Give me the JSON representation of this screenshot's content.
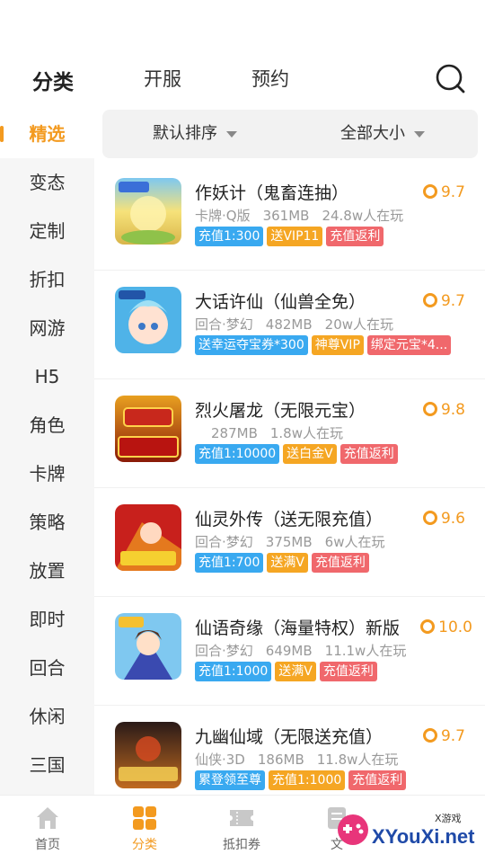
{
  "top_tabs": [
    {
      "label": "分类",
      "active": true
    },
    {
      "label": "开服",
      "active": false
    },
    {
      "label": "预约",
      "active": false
    }
  ],
  "sidebar": {
    "items": [
      {
        "label": "精选",
        "active": true
      },
      {
        "label": "变态"
      },
      {
        "label": "定制"
      },
      {
        "label": "折扣"
      },
      {
        "label": "网游"
      },
      {
        "label": "H5"
      },
      {
        "label": "角色"
      },
      {
        "label": "卡牌"
      },
      {
        "label": "策略"
      },
      {
        "label": "放置"
      },
      {
        "label": "即时"
      },
      {
        "label": "回合"
      },
      {
        "label": "休闲"
      },
      {
        "label": "三国"
      }
    ]
  },
  "filters": {
    "sort": "默认排序",
    "size": "全部大小"
  },
  "games": [
    {
      "name": "作妖计（鬼畜连抽）",
      "genre": "卡牌·Q版",
      "size": "361MB",
      "players": "24.8w人在玩",
      "rating": "9.7",
      "icon": "game-icon-zuoyaoji",
      "tags": [
        {
          "text": "充值1:300",
          "color": "blue"
        },
        {
          "text": "送VIP11",
          "color": "orange"
        },
        {
          "text": "充值返利",
          "color": "red"
        }
      ]
    },
    {
      "name": "大话许仙（仙兽全免）",
      "genre": "回合·梦幻",
      "size": "482MB",
      "players": "20w人在玩",
      "rating": "9.7",
      "icon": "game-icon-dahuaxuxian",
      "tags": [
        {
          "text": "送幸运夺宝券*300",
          "color": "blue"
        },
        {
          "text": "神尊VIP",
          "color": "orange"
        },
        {
          "text": "绑定元宝*4...",
          "color": "red"
        }
      ]
    },
    {
      "name": "烈火屠龙（无限元宝）",
      "genre": "",
      "size": "287MB",
      "players": "1.8w人在玩",
      "rating": "9.8",
      "icon": "game-icon-liehuotulong",
      "tags": [
        {
          "text": "充值1:10000",
          "color": "blue"
        },
        {
          "text": "送白金V",
          "color": "orange"
        },
        {
          "text": "充值返利",
          "color": "red"
        }
      ]
    },
    {
      "name": "仙灵外传（送无限充值）",
      "genre": "回合·梦幻",
      "size": "375MB",
      "players": "6w人在玩",
      "rating": "9.6",
      "icon": "game-icon-xianlingwaizhuan",
      "tags": [
        {
          "text": "充值1:700",
          "color": "blue"
        },
        {
          "text": "送满V",
          "color": "orange"
        },
        {
          "text": "充值返利",
          "color": "red"
        }
      ]
    },
    {
      "name": "仙语奇缘（海量特权）新版",
      "genre": "回合·梦幻",
      "size": "649MB",
      "players": "11.1w人在玩",
      "rating": "10.0",
      "icon": "game-icon-xianyuqiyuan",
      "tags": [
        {
          "text": "充值1:1000",
          "color": "blue"
        },
        {
          "text": "送满V",
          "color": "orange"
        },
        {
          "text": "充值返利",
          "color": "red"
        }
      ]
    },
    {
      "name": "九幽仙域（无限送充值）",
      "genre": "仙侠·3D",
      "size": "186MB",
      "players": "11.8w人在玩",
      "rating": "9.7",
      "icon": "game-icon-jiuyouxianyu",
      "tags": [
        {
          "text": "累登领至尊",
          "color": "blue"
        },
        {
          "text": "充值1:1000",
          "color": "orange"
        },
        {
          "text": "充值返利",
          "color": "red"
        }
      ]
    }
  ],
  "bottom_nav": [
    {
      "label": "首页",
      "icon": "home-icon",
      "active": false
    },
    {
      "label": "分类",
      "icon": "category-icon",
      "active": true
    },
    {
      "label": "抵扣券",
      "icon": "coupon-icon",
      "active": false
    },
    {
      "label": "文",
      "icon": "article-icon",
      "active": false
    }
  ],
  "watermark": {
    "small": "X游戏",
    "text": "XYouXi.net"
  },
  "colors": {
    "accent": "#f39a1f",
    "tag_blue": "#39a9f0",
    "tag_orange": "#f5a623",
    "tag_red": "#f0686c"
  }
}
